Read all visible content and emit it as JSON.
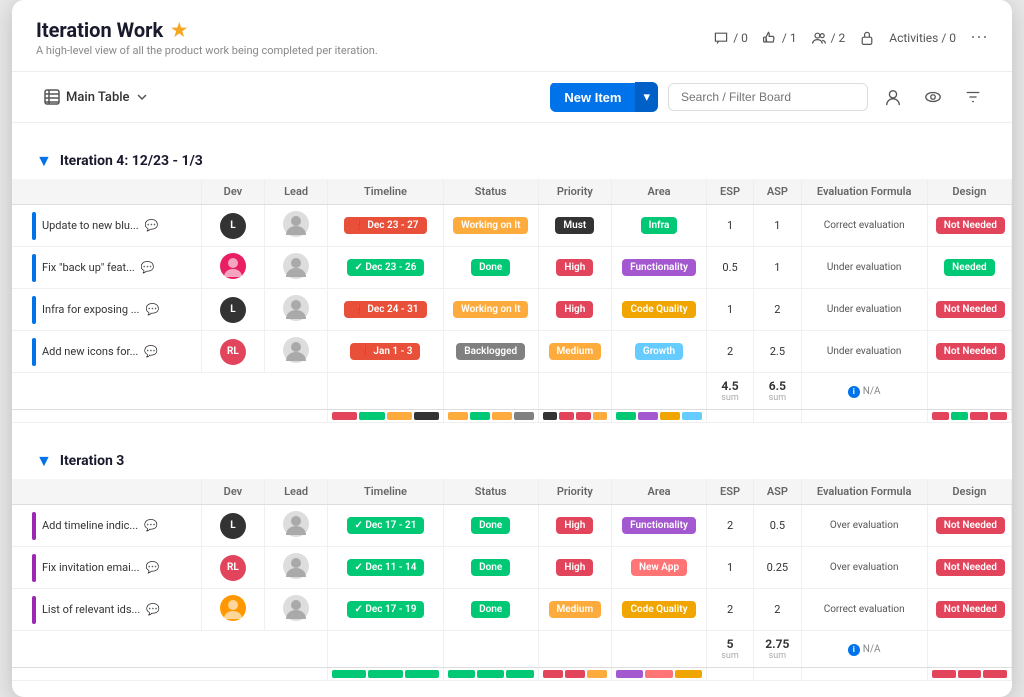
{
  "app": {
    "title": "Iteration Work",
    "subtitle": "A high-level view of all the product work being completed per iteration.",
    "star": "★"
  },
  "header_actions": [
    {
      "icon": "chat-icon",
      "label": "/ 0"
    },
    {
      "icon": "activity-icon",
      "label": "/ 1"
    },
    {
      "icon": "people-icon",
      "label": "/ 2"
    },
    {
      "icon": "lock-icon",
      "label": ""
    },
    {
      "icon": "activities-label",
      "label": "Activities / 0"
    }
  ],
  "toolbar": {
    "table_label": "Main Table",
    "new_item_label": "New Item",
    "search_placeholder": "Search / Filter Board"
  },
  "iteration4": {
    "title": "Iteration 4: 12/23 - 1/3",
    "columns": [
      "Dev",
      "Lead",
      "Timeline",
      "Status",
      "Priority",
      "Area",
      "ESP",
      "ASP",
      "Evaluation Formula",
      "Design"
    ],
    "rows": [
      {
        "name": "Update to new blu...",
        "dev_initials": "L",
        "dev_color": "#333",
        "lead": "person",
        "timeline": "Dec 23 - 27",
        "timeline_type": "exclaim",
        "status": "Working on It",
        "status_color": "#fdab3d",
        "priority": "Must",
        "priority_color": "#333",
        "area": "Infra",
        "area_color": "#00c875",
        "esp": "1",
        "asp": "1",
        "eval": "Correct evaluation",
        "design": "Not Needed",
        "design_color": "#e2445c",
        "indent_color": "#0073ea"
      },
      {
        "name": "Fix \"back up\" feat...",
        "dev_initials": "face",
        "dev_color": "#e91e63",
        "lead": "person",
        "timeline": "Dec 23 - 26",
        "timeline_type": "check",
        "status": "Done",
        "status_color": "#00c875",
        "priority": "High",
        "priority_color": "#e2445c",
        "area": "Functionality",
        "area_color": "#a358d0",
        "esp": "0.5",
        "asp": "1",
        "eval": "Under evaluation",
        "design": "Needed",
        "design_color": "#00c875",
        "indent_color": "#0073ea"
      },
      {
        "name": "Infra for exposing ...",
        "dev_initials": "L",
        "dev_color": "#333",
        "lead": "person",
        "timeline": "Dec 24 - 31",
        "timeline_type": "exclaim",
        "status": "Working on It",
        "status_color": "#fdab3d",
        "priority": "High",
        "priority_color": "#e2445c",
        "area": "Code Quality",
        "area_color": "#f0a500",
        "esp": "1",
        "asp": "2",
        "eval": "Under evaluation",
        "design": "Not Needed",
        "design_color": "#e2445c",
        "indent_color": "#0073ea"
      },
      {
        "name": "Add new icons for...",
        "dev_initials": "RL",
        "dev_color": "#e2445c",
        "lead": "person",
        "timeline": "Jan 1 - 3",
        "timeline_type": "exclaim",
        "status": "Backlogged",
        "status_color": "#808080",
        "priority": "Medium",
        "priority_color": "#fdab3d",
        "area": "Growth",
        "area_color": "#66ccff",
        "esp": "2",
        "asp": "2.5",
        "eval": "Under evaluation",
        "design": "Not Needed",
        "design_color": "#e2445c",
        "indent_color": "#0073ea"
      }
    ],
    "sum": {
      "esp": "4.5",
      "asp": "6.5",
      "eval_na": "N/A"
    },
    "color_bars_timeline": [
      "#e2445c",
      "#00c875",
      "#fdab3d",
      "#333"
    ],
    "color_bars_status": [
      "#fdab3d",
      "#00c875",
      "#fdab3d",
      "#808080"
    ],
    "color_bars_priority": [
      "#333",
      "#e2445c",
      "#e2445c",
      "#fdab3d"
    ],
    "color_bars_area": [
      "#00c875",
      "#a358d0",
      "#f0a500",
      "#66ccff"
    ],
    "color_bars_design": [
      "#e2445c",
      "#00c875",
      "#e2445c",
      "#e2445c"
    ]
  },
  "iteration3": {
    "title": "Iteration 3",
    "columns": [
      "Dev",
      "Lead",
      "Timeline",
      "Status",
      "Priority",
      "Area",
      "ESP",
      "ASP",
      "Evaluation Formula",
      "Design"
    ],
    "rows": [
      {
        "name": "Add timeline indic...",
        "dev_initials": "L",
        "dev_color": "#333",
        "lead": "person",
        "timeline": "Dec 17 - 21",
        "timeline_type": "check",
        "status": "Done",
        "status_color": "#00c875",
        "priority": "High",
        "priority_color": "#e2445c",
        "area": "Functionality",
        "area_color": "#a358d0",
        "esp": "2",
        "asp": "0.5",
        "eval": "Over evaluation",
        "design": "Not Needed",
        "design_color": "#e2445c",
        "indent_color": "#9c27b0"
      },
      {
        "name": "Fix invitation emai...",
        "dev_initials": "RL",
        "dev_color": "#e2445c",
        "lead": "person",
        "timeline": "Dec 11 - 14",
        "timeline_type": "check",
        "status": "Done",
        "status_color": "#00c875",
        "priority": "High",
        "priority_color": "#e2445c",
        "area": "New App",
        "area_color": "#ff7575",
        "esp": "1",
        "asp": "0.25",
        "eval": "Over evaluation",
        "design": "Not Needed",
        "design_color": "#e2445c",
        "indent_color": "#9c27b0"
      },
      {
        "name": "List of relevant ids...",
        "dev_initials": "face2",
        "dev_color": "#ff9800",
        "lead": "person",
        "timeline": "Dec 17 - 19",
        "timeline_type": "check",
        "status": "Done",
        "status_color": "#00c875",
        "priority": "Medium",
        "priority_color": "#fdab3d",
        "area": "Code Quality",
        "area_color": "#f0a500",
        "esp": "2",
        "asp": "2",
        "eval": "Correct evaluation",
        "design": "Not Needed",
        "design_color": "#e2445c",
        "indent_color": "#9c27b0"
      }
    ],
    "sum": {
      "esp": "5",
      "asp": "2.75",
      "eval_na": "N/A"
    },
    "color_bars_timeline": [
      "#00c875",
      "#00c875",
      "#00c875"
    ],
    "color_bars_status": [
      "#00c875",
      "#00c875",
      "#00c875"
    ],
    "color_bars_priority": [
      "#e2445c",
      "#e2445c",
      "#fdab3d"
    ],
    "color_bars_area": [
      "#a358d0",
      "#ff7575",
      "#f0a500"
    ],
    "color_bars_design": [
      "#e2445c",
      "#e2445c",
      "#e2445c"
    ]
  }
}
